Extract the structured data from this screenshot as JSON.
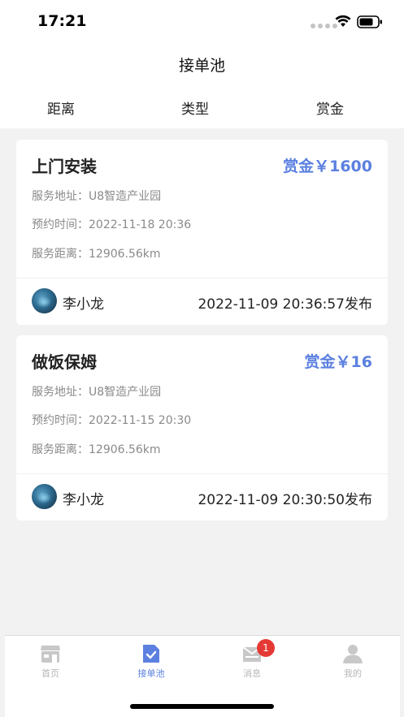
{
  "status": {
    "time": "17:21"
  },
  "nav": {
    "title": "接单池"
  },
  "filters": [
    "距离",
    "类型",
    "赏金"
  ],
  "orders": [
    {
      "title": "上门安装",
      "reward": "赏金￥1600",
      "address": "服务地址：U8智造产业园",
      "appointment": "预约时间：2022-11-18 20:36",
      "distance": "服务距离：12906.56km",
      "user": "李小龙",
      "published": "2022-11-09 20:36:57发布"
    },
    {
      "title": "做饭保姆",
      "reward": "赏金￥16",
      "address": "服务地址：U8智造产业园",
      "appointment": "预约时间：2022-11-15 20:30",
      "distance": "服务距离：12906.56km",
      "user": "李小龙",
      "published": "2022-11-09 20:30:50发布"
    }
  ],
  "tabbar": {
    "items": [
      {
        "label": "首页",
        "icon": "store-icon",
        "active": false
      },
      {
        "label": "接单池",
        "icon": "order-check-icon",
        "active": true
      },
      {
        "label": "消息",
        "icon": "message-icon",
        "active": false,
        "badge": "1"
      },
      {
        "label": "我的",
        "icon": "user-icon",
        "active": false
      }
    ]
  },
  "colors": {
    "accent": "#5b80e0",
    "badge": "#e53935"
  }
}
